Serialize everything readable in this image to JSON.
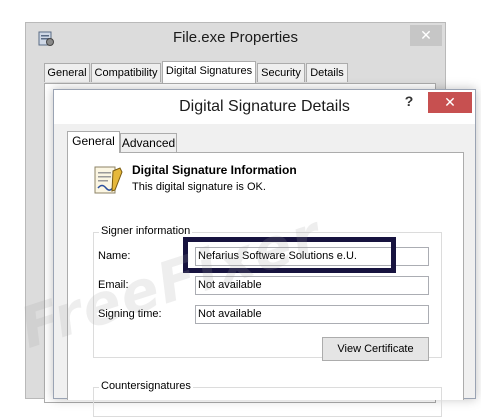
{
  "outer_window": {
    "title": "File.exe Properties",
    "close_glyph": "✕",
    "tabs": [
      {
        "label": "General",
        "selected": false
      },
      {
        "label": "Compatibility",
        "selected": false
      },
      {
        "label": "Digital Signatures",
        "selected": true
      },
      {
        "label": "Security",
        "selected": false
      },
      {
        "label": "Details",
        "selected": false
      }
    ]
  },
  "dialog": {
    "title": "Digital Signature Details",
    "help_glyph": "?",
    "close_glyph": "✕",
    "tabs": [
      {
        "label": "General",
        "selected": true
      },
      {
        "label": "Advanced",
        "selected": false
      }
    ],
    "info": {
      "heading": "Digital Signature Information",
      "status": "This digital signature is OK."
    },
    "signer": {
      "group_label": "Signer information",
      "name_label": "Name:",
      "name_value": "Nefarius Software Solutions e.U.",
      "email_label": "Email:",
      "email_value": "Not available",
      "time_label": "Signing time:",
      "time_value": "Not available",
      "view_button": "View Certificate"
    },
    "countersignatures_label": "Countersignatures"
  },
  "watermark": "FreeFixer",
  "colors": {
    "highlight_border": "#17133f",
    "close_red": "#c75050"
  }
}
